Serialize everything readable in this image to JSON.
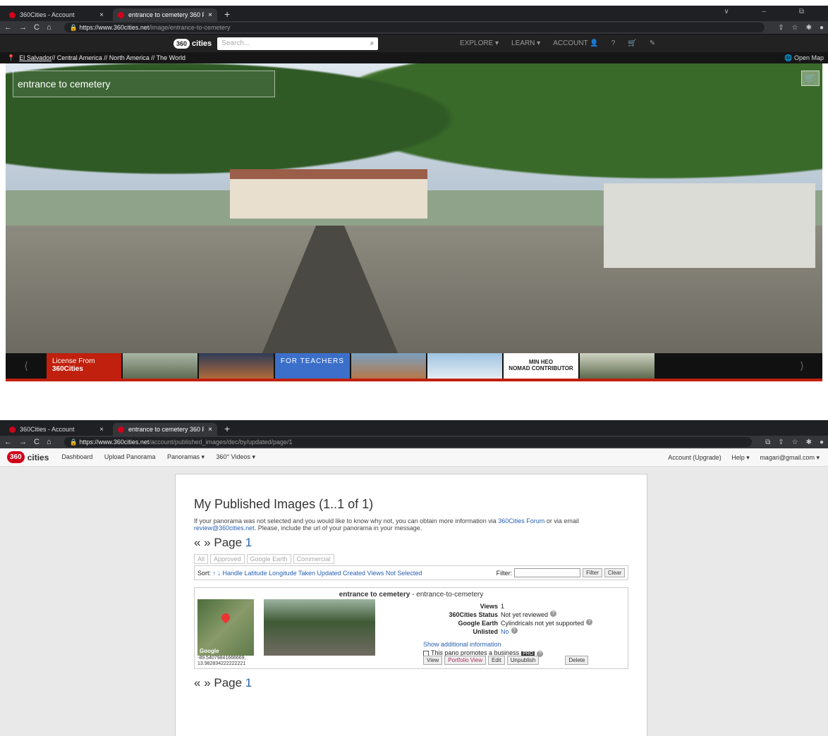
{
  "shot1": {
    "tabs": [
      {
        "title": "360Cities - Account",
        "close": "×"
      },
      {
        "title": "entrance to cemetery 360 Panora",
        "close": "×"
      }
    ],
    "new_tab": "+",
    "window_controls": "∨ – ⧉",
    "url_host": "https://www.360cities.net",
    "url_path": "/image/entrance-to-cemetery",
    "logo_badge": "360",
    "logo_text": "cities",
    "search_placeholder": "Search...",
    "nav": [
      "EXPLORE ▾",
      "LEARN ▾",
      "ACCOUNT 👤",
      "?",
      "🛒",
      "✎"
    ],
    "location": {
      "pin_icon": "📍",
      "country": "El Salvador",
      "rest": " // Central America // North America // The World",
      "open_map": "🌐 Open Map"
    },
    "pano_title": "entrance to cemetery",
    "strip": {
      "license_line1": "License From",
      "license_line2": "360Cities",
      "teachers": "FOR TEACHERS",
      "nomad_line1": "MIN HEO",
      "nomad_line2": "NOMAD CONTRIBUTOR"
    }
  },
  "shot2": {
    "tabs": [
      {
        "title": "360Cities - Account",
        "close": "×"
      },
      {
        "title": "entrance to cemetery 360 Panora",
        "close": "×"
      }
    ],
    "new_tab": "+",
    "url_host": "https://www.360cities.net",
    "url_path": "/account/published_images/dec/by/updated/page/1",
    "logo_badge": "360",
    "logo_text": "cities",
    "menu": [
      "Dashboard",
      "Upload Panorama",
      "Panoramas ▾",
      "360° Videos ▾"
    ],
    "right_menu": [
      "Account (Upgrade)",
      "Help ▾",
      "magari@gmail.com ▾"
    ],
    "heading": "My Published Images (1..1 of 1)",
    "info_text": "If your panorama was not selected and you would like to know why not, you can obtain more information via",
    "info_link1": "360Cities Forum",
    "info_mid": "or via email",
    "info_link2": "review@360cities.net",
    "info_end": ". Please, include the url of your panorama in your message.",
    "pager_arrows": "« » Page",
    "pager_num": "1",
    "filter_tabs": [
      "All",
      "Approved",
      "Google Earth",
      "Commercial"
    ],
    "sort_label": "Sort:",
    "sort_links": "↑ ↓ Handle Latitude Longitude Taken Updated Created Views Not Selected",
    "filter_label": "Filter:",
    "filter_btn": "Filter",
    "clear_btn": "Clear",
    "item": {
      "title": "entrance to cemetery",
      "handle": " - entrance-to-cemetery",
      "map_label": "Google",
      "coords_line1": "-89.54079841666669,",
      "coords_line2": "13.982834222222221",
      "fields": [
        {
          "k": "Views",
          "v": "1"
        },
        {
          "k": "360Cities Status",
          "v": "Not yet reviewed"
        },
        {
          "k": "Google Earth",
          "v": "Cylindricals not yet supported"
        },
        {
          "k": "Unlisted",
          "v": "No"
        }
      ],
      "show_more": "Show additional information",
      "promote": "This pano promotes a business",
      "pro_badge": "PRO",
      "actions": [
        "View",
        "Portfolio View",
        "Edit",
        "Unpublish",
        "Delete"
      ]
    }
  }
}
